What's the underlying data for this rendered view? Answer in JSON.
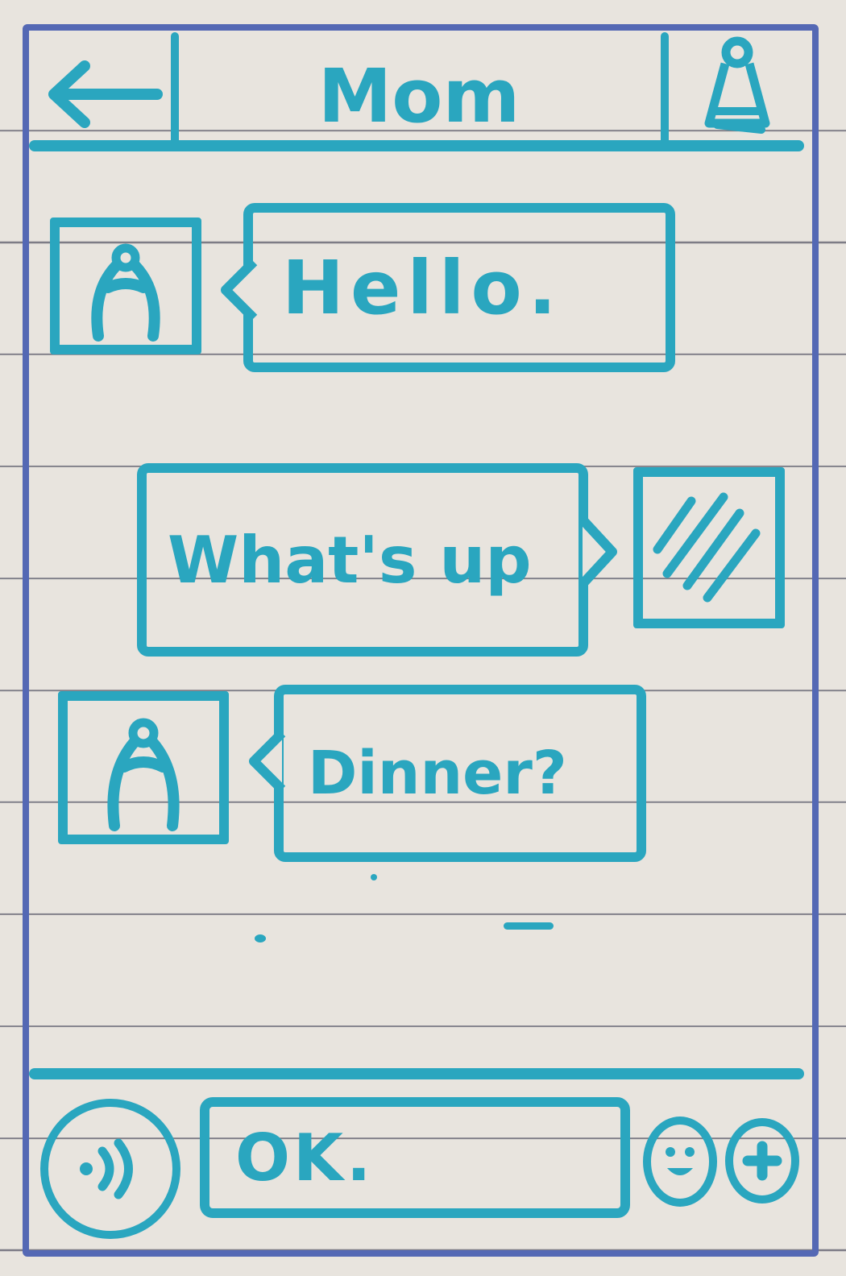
{
  "header": {
    "title": "Mom",
    "back_icon": "arrow-left-icon",
    "profile_icon": "user-icon"
  },
  "messages": [
    {
      "sender": "contact",
      "text": "Hello."
    },
    {
      "sender": "self",
      "text": "What's up"
    },
    {
      "sender": "contact",
      "text": "Dinner?"
    }
  ],
  "composer": {
    "value": "OK.",
    "voice_icon": "voice-icon",
    "emoji_icon": "emoji-icon",
    "add_icon": "plus-icon"
  },
  "colors": {
    "ink": "#2aa6bf",
    "frame": "#5468b4",
    "paper": "#e8e4de"
  }
}
